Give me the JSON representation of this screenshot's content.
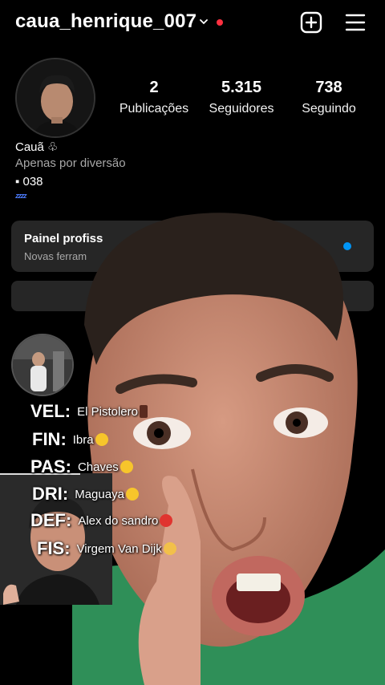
{
  "header": {
    "username": "caua_henrique_007"
  },
  "stats": [
    {
      "value": "2",
      "label": "Publicações"
    },
    {
      "value": "5.315",
      "label": "Seguidores"
    },
    {
      "value": "738",
      "label": "Seguindo"
    }
  ],
  "profile": {
    "name": "Cauã ♧",
    "bio": "Apenas por diversão",
    "line3": "▪ 038",
    "zzz": "ᶻᶻᶻᶻ"
  },
  "panel": {
    "title": "Painel profiss",
    "subtitle": "Novas ferram"
  },
  "overlay_card": {
    "rows": [
      {
        "pos": "VEL:",
        "name": "El Pistolero"
      },
      {
        "pos": "FIN:",
        "name": "Ibra"
      },
      {
        "pos": "PAS:",
        "name": "Chaves"
      },
      {
        "pos": "DRI:",
        "name": "Maguaya"
      },
      {
        "pos": "DEF:",
        "name": "Alex do sandro"
      },
      {
        "pos": "FIS:",
        "name": "Virgem Van Dijk"
      }
    ]
  },
  "colors": {
    "notification_dot": "#ff3040",
    "panel_dot": "#0095f6",
    "panel_bg": "#262626"
  }
}
